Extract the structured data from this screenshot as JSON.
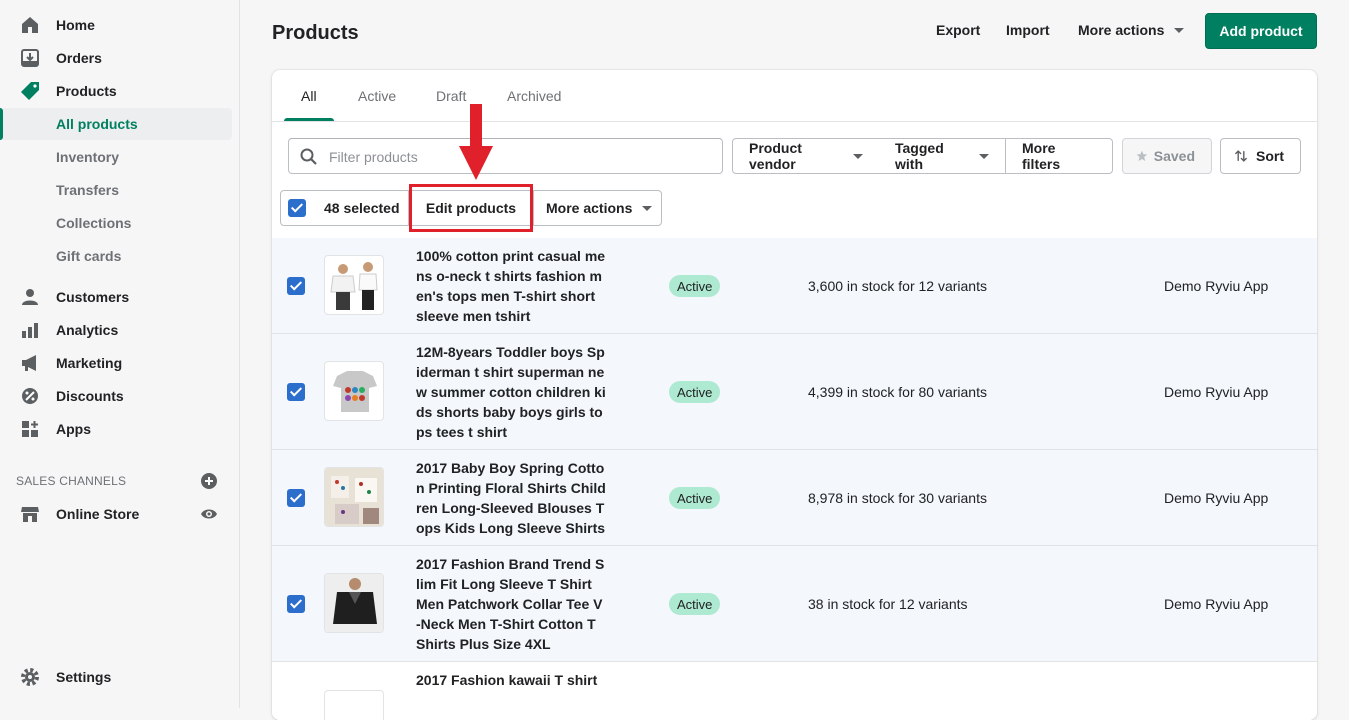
{
  "sidebar": {
    "items": [
      {
        "label": "Home",
        "icon": "home-icon"
      },
      {
        "label": "Orders",
        "icon": "orders-icon"
      },
      {
        "label": "Products",
        "icon": "tag-icon"
      }
    ],
    "product_subitems": [
      "All products",
      "Inventory",
      "Transfers",
      "Collections",
      "Gift cards"
    ],
    "items2": [
      {
        "label": "Customers",
        "icon": "customer-icon"
      },
      {
        "label": "Analytics",
        "icon": "analytics-icon"
      },
      {
        "label": "Marketing",
        "icon": "megaphone-icon"
      },
      {
        "label": "Discounts",
        "icon": "discount-icon"
      },
      {
        "label": "Apps",
        "icon": "apps-icon"
      }
    ],
    "sales_channels_label": "SALES CHANNELS",
    "online_store": "Online Store",
    "settings": "Settings"
  },
  "header": {
    "title": "Products",
    "export": "Export",
    "import": "Import",
    "more_actions": "More actions",
    "add_product": "Add product"
  },
  "tabs": [
    "All",
    "Active",
    "Draft",
    "Archived"
  ],
  "filters": {
    "search_placeholder": "Filter products",
    "product_vendor": "Product vendor",
    "tagged_with": "Tagged with",
    "more_filters": "More filters",
    "saved": "Saved",
    "sort": "Sort"
  },
  "bulk": {
    "selected": "48 selected",
    "edit_products": "Edit products",
    "more_actions": "More actions"
  },
  "products": [
    {
      "title": "100% cotton print casual mens o-neck t shirts fashion men's tops men T-shirt short sleeve men tshirt",
      "status": "Active",
      "stock": "3,600 in stock for 12 variants",
      "vendor": "Demo Ryviu App"
    },
    {
      "title": "12M-8years Toddler boys Spiderman t shirt superman new summer cotton children kids shorts baby boys girls tops tees t shirt",
      "status": "Active",
      "stock": "4,399 in stock for 80 variants",
      "vendor": "Demo Ryviu App"
    },
    {
      "title": "2017 Baby Boy Spring Cotton Printing Floral Shirts Children Long-Sleeved Blouses Tops Kids Long Sleeve Shirts",
      "status": "Active",
      "stock": "8,978 in stock for 30 variants",
      "vendor": "Demo Ryviu App"
    },
    {
      "title": "2017 Fashion Brand Trend Slim Fit Long Sleeve T Shirt Men Patchwork Collar Tee V-Neck Men T-Shirt Cotton T Shirts Plus Size 4XL",
      "status": "Active",
      "stock": "38 in stock for 12 variants",
      "vendor": "Demo Ryviu App"
    },
    {
      "title": "2017 Fashion kawaii T shirt",
      "status": "",
      "stock": "",
      "vendor": ""
    }
  ],
  "colors": {
    "accent": "#008060",
    "checkbox": "#2c6ecb",
    "badge": "#aee9d1",
    "highlight": "#e0202a"
  }
}
